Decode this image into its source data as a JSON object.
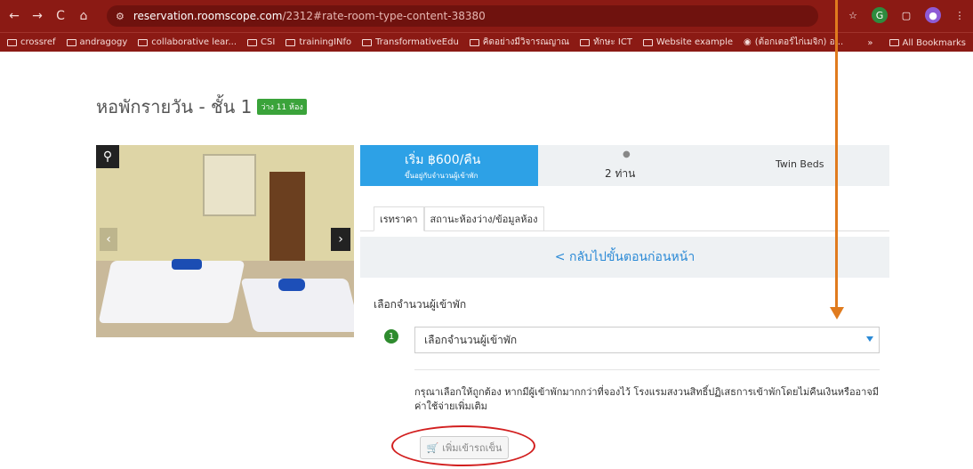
{
  "browser": {
    "url_host": "reservation.roomscope.com",
    "url_path": "/2312#rate-room-type-content-38380",
    "nav": {
      "back": "←",
      "forward": "→",
      "reload": "C",
      "home": "⌂"
    },
    "bookmarks": [
      {
        "label": "crossref",
        "icon": "folder-icon"
      },
      {
        "label": "andragogy",
        "icon": "folder-icon"
      },
      {
        "label": "collaborative lear...",
        "icon": "folder-icon"
      },
      {
        "label": "CSI",
        "icon": "folder-icon"
      },
      {
        "label": "trainingINfo",
        "icon": "folder-icon"
      },
      {
        "label": "TransformativeEdu",
        "icon": "folder-icon"
      },
      {
        "label": "คิดอย่างมีวิจารณญาณ",
        "icon": "folder-icon"
      },
      {
        "label": "ทักษะ ICT",
        "icon": "folder-icon"
      },
      {
        "label": "Website example",
        "icon": "folder-icon"
      },
      {
        "label": "(ต้อกเตอร์ไก่เมจิก) อ...",
        "icon": "globe-icon"
      }
    ],
    "bookmarks_more": "»",
    "all_bookmarks": "All Bookmarks"
  },
  "page": {
    "title": "หอพักรายวัน - ชั้น 1",
    "badge": "ว่าง 11 ห้อง"
  },
  "rate": {
    "price_main": "เริ่ม ฿600/คืน",
    "price_sub": "ขึ้นอยู่กับจำนวนผู้เข้าพัก",
    "guests": "2 ท่าน",
    "bed_type": "Twin Beds"
  },
  "tabs": [
    {
      "label": "เรทราคา",
      "active": true
    },
    {
      "label": "สถานะห้องว่าง/ข้อมูลห้อง",
      "active": false
    }
  ],
  "back_link": "< กลับไปขั้นตอนก่อนหน้า",
  "form": {
    "section_label": "เลือกจำนวนผู้เข้าพัก",
    "step": "1",
    "select_value": "เลือกจำนวนผู้เข้าพัก",
    "notice": "กรุณาเลือกให้ถูกต้อง หากมีผู้เข้าพักมากกว่าที่จองไว้ โรงแรมสงวนสิทธิ์ปฏิเสธการเข้าพักโดยไม่คืนเงินหรืออาจมีค่าใช้จ่ายเพิ่มเติม",
    "cart_button": "เพิ่มเข้ารถเข็น"
  },
  "colors": {
    "browser_chrome": "#8b1a14",
    "price_box": "#2da1e6",
    "link_blue": "#2b8ad6",
    "badge_green": "#3aa33a",
    "annotation_arrow": "#e07b1e",
    "annotation_circle": "#d21f1f"
  }
}
